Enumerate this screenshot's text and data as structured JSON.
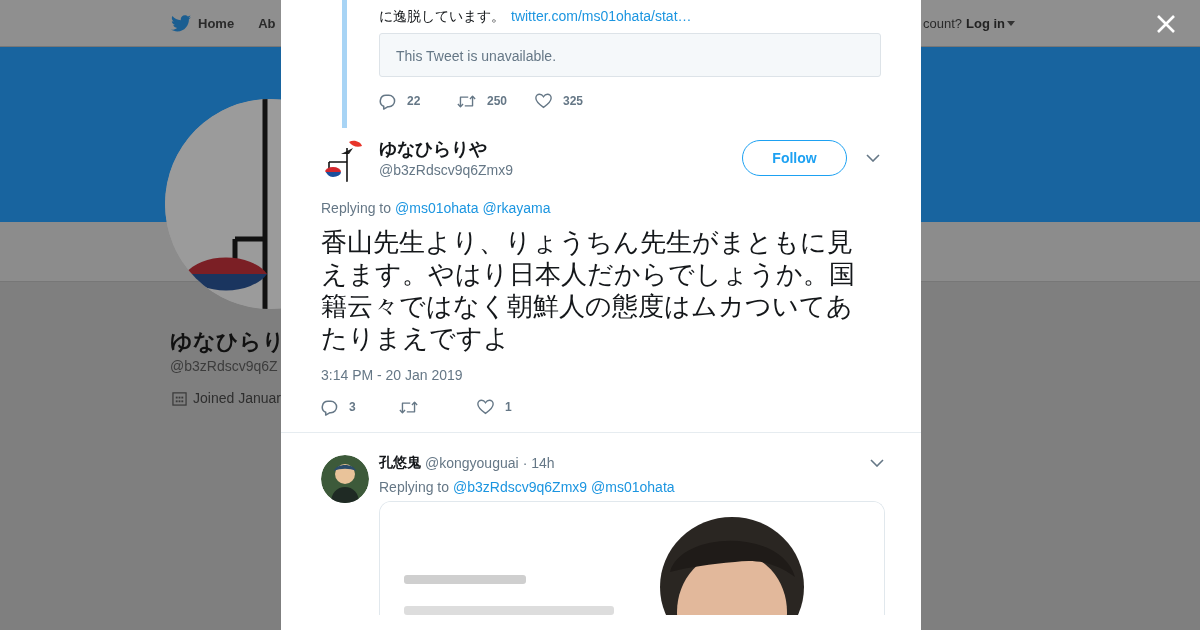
{
  "nav": {
    "items": [
      {
        "label": "Home",
        "kind": "home"
      },
      {
        "label": "Ab",
        "kind": "plain"
      }
    ],
    "signup_prompt": "count?",
    "login": "Log in"
  },
  "profile": {
    "name": "ゆなひらり",
    "handle": "@b3zRdscv9q6Z",
    "joined": "Joined Januar"
  },
  "modal": {
    "quoted_tweet": {
      "text_end": "に逸脱しています。",
      "link": "twitter.com/ms01ohata/stat…",
      "unavailable": "This Tweet is unavailable.",
      "replies": "22",
      "retweets": "250",
      "likes": "325"
    },
    "tweet": {
      "name": "ゆなひらりや",
      "handle": "@b3zRdscv9q6Zmx9",
      "follow": "Follow",
      "replying_label": "Replying to",
      "replying_to": [
        "@ms01ohata",
        "@rkayama"
      ],
      "text": "香山先生より、りょうちん先生がまともに見えます。やはり日本人だからでしょうか。国籍云々ではなく朝鮮人の態度はムカついてあたりまえですよ",
      "time": "3:14 PM - 20 Jan 2019",
      "replies": "3",
      "likes": "1"
    },
    "replies": [
      {
        "name": "孔悠鬼",
        "handle": "@kongyouguai",
        "age": "· 14h",
        "replying_label": "Replying to",
        "replying_to": [
          "@b3zRdscv9q6Zmx9",
          "@ms01ohata"
        ]
      }
    ]
  }
}
